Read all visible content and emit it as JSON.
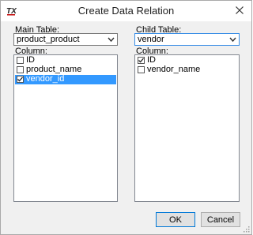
{
  "window": {
    "title": "Create Data Relation",
    "app_icon_label": "TX"
  },
  "main_table": {
    "label": "Main Table:",
    "selected": "product_product",
    "column_label": "Column:",
    "columns": [
      {
        "name": "ID",
        "checked": false,
        "selected": false
      },
      {
        "name": "product_name",
        "checked": false,
        "selected": false
      },
      {
        "name": "vendor_id",
        "checked": true,
        "selected": true
      }
    ]
  },
  "child_table": {
    "label": "Child Table:",
    "selected": "vendor",
    "column_label": "Column:",
    "columns": [
      {
        "name": "ID",
        "checked": true,
        "selected": false
      },
      {
        "name": "vendor_name",
        "checked": false,
        "selected": false
      }
    ]
  },
  "buttons": {
    "ok": "OK",
    "cancel": "Cancel"
  }
}
